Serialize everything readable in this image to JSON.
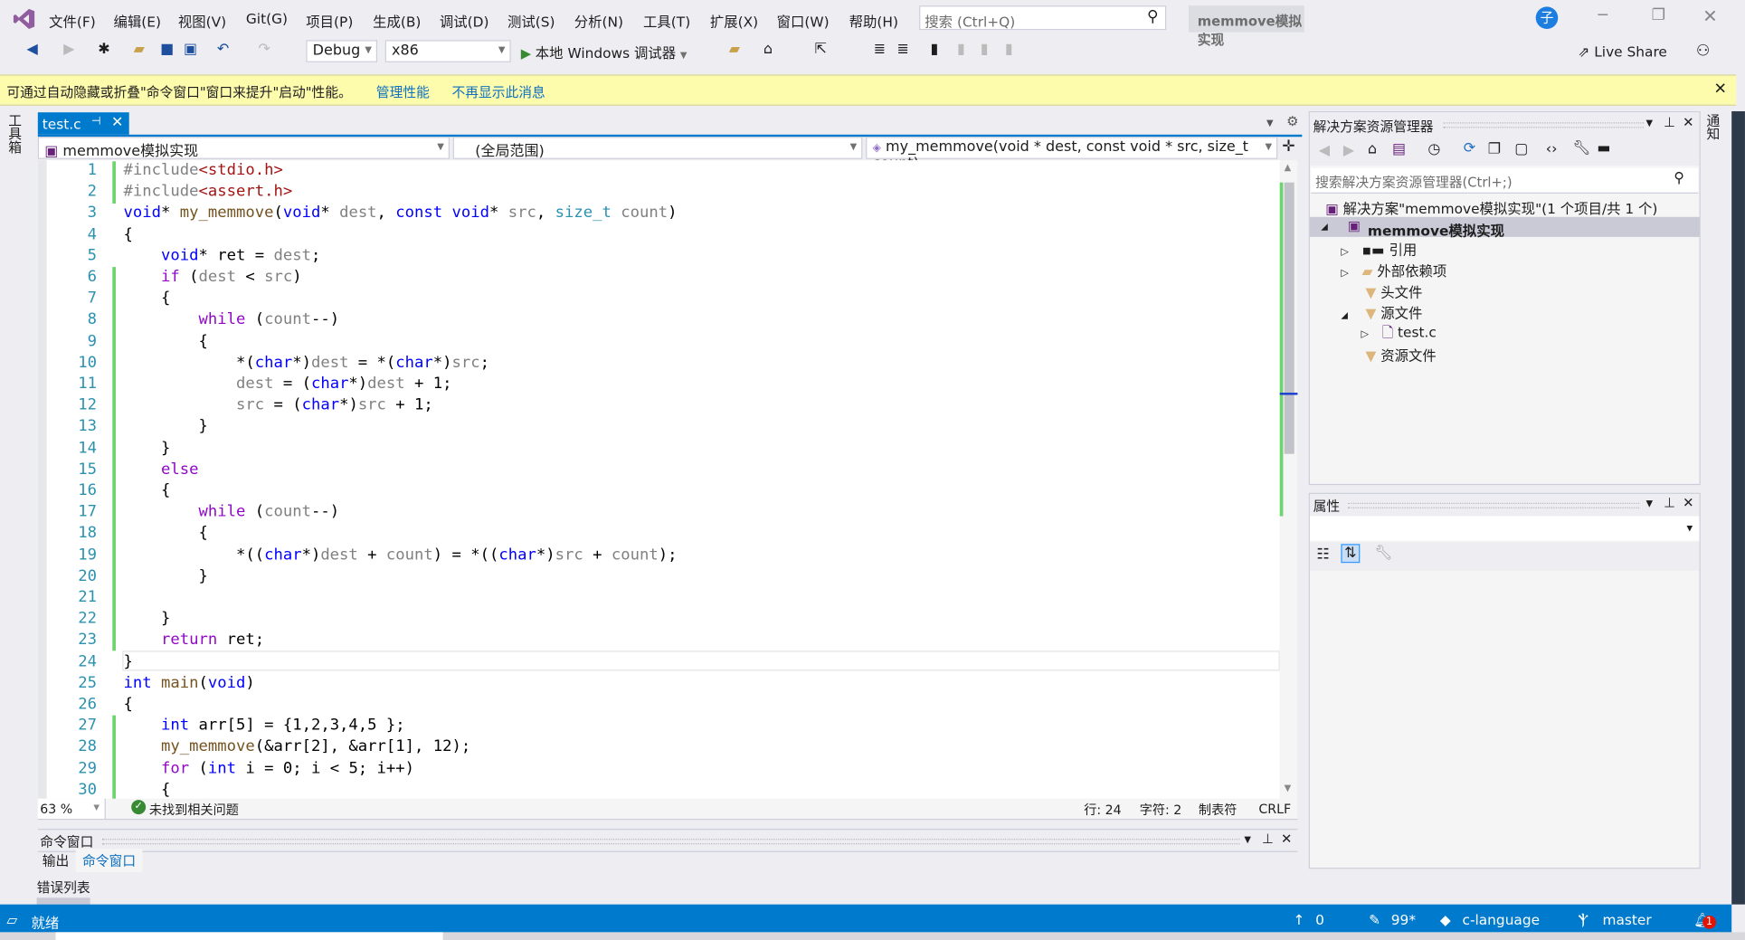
{
  "title_bar": {
    "menus": [
      "文件(F)",
      "编辑(E)",
      "视图(V)",
      "Git(G)",
      "项目(P)",
      "生成(B)",
      "调试(D)",
      "测试(S)",
      "分析(N)",
      "工具(T)",
      "扩展(X)",
      "窗口(W)",
      "帮助(H)"
    ],
    "search_placeholder": "搜索 (Ctrl+Q)",
    "solution_name": "memmove模拟实现",
    "avatar": "子"
  },
  "toolbar": {
    "config": "Debug",
    "platform": "x86",
    "run_label": "本地 Windows 调试器",
    "live_share": "Live Share"
  },
  "infobar": {
    "message": "可通过自动隐藏或折叠\"命令窗口\"窗口来提升\"启动\"性能。",
    "link1": "管理性能",
    "link2": "不再显示此消息"
  },
  "left_strip": {
    "label": "工具箱"
  },
  "right_strip": {
    "label": "通知"
  },
  "editor": {
    "tab": "test.c",
    "nav_project": "memmove模拟实现",
    "nav_scope": "(全局范围)",
    "nav_member": "my_memmove(void * dest, const void * src, size_t count)",
    "lines": [
      [
        [
          "#include",
          "pp"
        ],
        [
          "<stdio.h>",
          "str"
        ]
      ],
      [
        [
          "#include",
          "pp"
        ],
        [
          "<assert.h>",
          "str"
        ]
      ],
      [
        [
          "void",
          "kw"
        ],
        [
          "* ",
          "tx"
        ],
        [
          "my_memmove",
          "fn"
        ],
        [
          "(",
          "tx"
        ],
        [
          "void",
          "kw"
        ],
        [
          "* ",
          "tx"
        ],
        [
          "dest",
          "prm"
        ],
        [
          ", ",
          "tx"
        ],
        [
          "const",
          "kw"
        ],
        [
          " ",
          "tx"
        ],
        [
          "void",
          "kw"
        ],
        [
          "* ",
          "tx"
        ],
        [
          "src",
          "prm"
        ],
        [
          ", ",
          "tx"
        ],
        [
          "size_t",
          "typ"
        ],
        [
          " ",
          "tx"
        ],
        [
          "count",
          "prm"
        ],
        [
          ")",
          "tx"
        ]
      ],
      [
        [
          "{",
          "tx"
        ]
      ],
      [
        [
          "    ",
          "tx"
        ],
        [
          "void",
          "kw"
        ],
        [
          "* ret = ",
          "tx"
        ],
        [
          "dest",
          "prm"
        ],
        [
          ";",
          "tx"
        ]
      ],
      [
        [
          "    ",
          "tx"
        ],
        [
          "if",
          "ctl"
        ],
        [
          " (",
          "tx"
        ],
        [
          "dest",
          "prm"
        ],
        [
          " < ",
          "tx"
        ],
        [
          "src",
          "prm"
        ],
        [
          ")",
          "tx"
        ]
      ],
      [
        [
          "    {",
          "tx"
        ]
      ],
      [
        [
          "        ",
          "tx"
        ],
        [
          "while",
          "ctl"
        ],
        [
          " (",
          "tx"
        ],
        [
          "count",
          "prm"
        ],
        [
          "--)",
          "tx"
        ]
      ],
      [
        [
          "        {",
          "tx"
        ]
      ],
      [
        [
          "            *(",
          "tx"
        ],
        [
          "char",
          "kw"
        ],
        [
          "*)",
          "tx"
        ],
        [
          "dest",
          "prm"
        ],
        [
          " = *(",
          "tx"
        ],
        [
          "char",
          "kw"
        ],
        [
          "*)",
          "tx"
        ],
        [
          "src",
          "prm"
        ],
        [
          ";",
          "tx"
        ]
      ],
      [
        [
          "            ",
          "tx"
        ],
        [
          "dest",
          "prm"
        ],
        [
          " = (",
          "tx"
        ],
        [
          "char",
          "kw"
        ],
        [
          "*)",
          "tx"
        ],
        [
          "dest",
          "prm"
        ],
        [
          " + 1;",
          "tx"
        ]
      ],
      [
        [
          "            ",
          "tx"
        ],
        [
          "src",
          "prm"
        ],
        [
          " = (",
          "tx"
        ],
        [
          "char",
          "kw"
        ],
        [
          "*)",
          "tx"
        ],
        [
          "src",
          "prm"
        ],
        [
          " + 1;",
          "tx"
        ]
      ],
      [
        [
          "        }",
          "tx"
        ]
      ],
      [
        [
          "    }",
          "tx"
        ]
      ],
      [
        [
          "    ",
          "tx"
        ],
        [
          "else",
          "ctl"
        ]
      ],
      [
        [
          "    {",
          "tx"
        ]
      ],
      [
        [
          "        ",
          "tx"
        ],
        [
          "while",
          "ctl"
        ],
        [
          " (",
          "tx"
        ],
        [
          "count",
          "prm"
        ],
        [
          "--)",
          "tx"
        ]
      ],
      [
        [
          "        {",
          "tx"
        ]
      ],
      [
        [
          "            *((",
          "tx"
        ],
        [
          "char",
          "kw"
        ],
        [
          "*)",
          "tx"
        ],
        [
          "dest",
          "prm"
        ],
        [
          " + ",
          "tx"
        ],
        [
          "count",
          "prm"
        ],
        [
          ") = *((",
          "tx"
        ],
        [
          "char",
          "kw"
        ],
        [
          "*)",
          "tx"
        ],
        [
          "src",
          "prm"
        ],
        [
          " + ",
          "tx"
        ],
        [
          "count",
          "prm"
        ],
        [
          ");",
          "tx"
        ]
      ],
      [
        [
          "        }",
          "tx"
        ]
      ],
      [
        [
          "",
          "tx"
        ]
      ],
      [
        [
          "    }",
          "tx"
        ]
      ],
      [
        [
          "    ",
          "tx"
        ],
        [
          "return",
          "ctl"
        ],
        [
          " ret;",
          "tx"
        ]
      ],
      [
        [
          "}",
          "tx"
        ]
      ],
      [
        [
          "int",
          "kw"
        ],
        [
          " ",
          "tx"
        ],
        [
          "main",
          "fn"
        ],
        [
          "(",
          "tx"
        ],
        [
          "void",
          "kw"
        ],
        [
          ")",
          "tx"
        ]
      ],
      [
        [
          "{",
          "tx"
        ]
      ],
      [
        [
          "    ",
          "tx"
        ],
        [
          "int",
          "kw"
        ],
        [
          " arr[5] = {1,2,3,4,5 };",
          "tx"
        ]
      ],
      [
        [
          "    ",
          "tx"
        ],
        [
          "my_memmove",
          "fn"
        ],
        [
          "(&arr[2], &arr[1], 12);",
          "tx"
        ]
      ],
      [
        [
          "    ",
          "tx"
        ],
        [
          "for",
          "ctl"
        ],
        [
          " (",
          "tx"
        ],
        [
          "int",
          "kw"
        ],
        [
          " i = 0; i < 5; i++)",
          "tx"
        ]
      ],
      [
        [
          "    {",
          "tx"
        ]
      ]
    ],
    "zoom": "63 %",
    "issues": "未找到相关问题",
    "line": "行: 24",
    "char": "字符: 2",
    "indent": "制表符",
    "eol": "CRLF"
  },
  "bottom_panel": {
    "title": "命令窗口",
    "tabs": [
      "输出",
      "命令窗口"
    ],
    "error_list": "错误列表"
  },
  "solution_explorer": {
    "title": "解决方案资源管理器",
    "search_placeholder": "搜索解决方案资源管理器(Ctrl+;)",
    "solution": "解决方案\"memmove模拟实现\"(1 个项目/共 1 个)",
    "project": "memmove模拟实现",
    "items": [
      "引用",
      "外部依赖项",
      "头文件",
      "源文件",
      "test.c",
      "资源文件"
    ]
  },
  "properties": {
    "title": "属性"
  },
  "status_bar": {
    "ready": "就绪",
    "up": "0",
    "edits": "99*",
    "repo": "c-language",
    "branch": "master",
    "notifications": "1"
  },
  "colors": {
    "accent": "#007acc",
    "infobar": "#fdfbac",
    "change_bar": "#6ed46e"
  }
}
